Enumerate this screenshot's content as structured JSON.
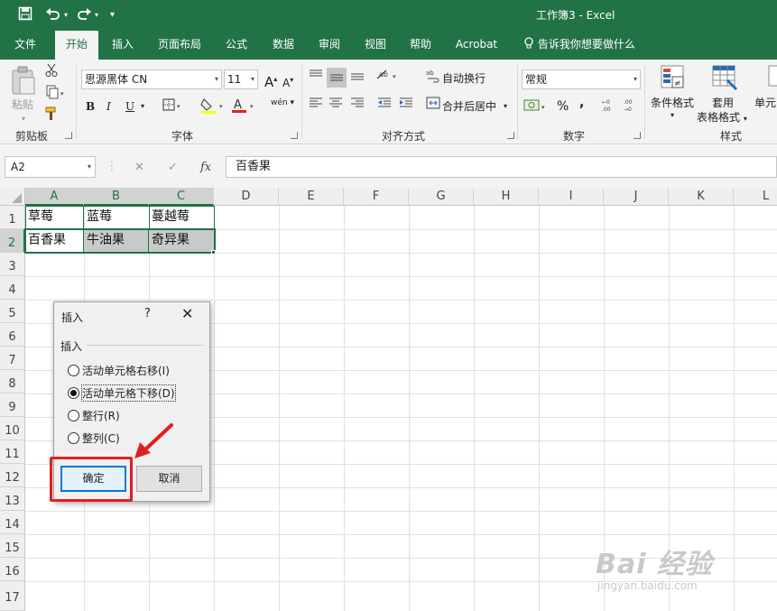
{
  "titlebar": {
    "title": "工作簿3  -  Excel",
    "save_icon": "save-icon",
    "undo_icon": "undo-icon",
    "redo_icon": "redo-icon"
  },
  "tabs": [
    "文件",
    "开始",
    "插入",
    "页面布局",
    "公式",
    "数据",
    "审阅",
    "视图",
    "帮助",
    "Acrobat",
    "告诉我你想要做什么"
  ],
  "active_tab": "开始",
  "ribbon": {
    "clipboard": {
      "paste": "粘贴",
      "label": "剪贴板"
    },
    "font": {
      "name": "思源黑体 CN",
      "size": "11",
      "bold": "B",
      "italic": "I",
      "underline": "U",
      "grow": "A",
      "shrink": "A",
      "font_color": "A",
      "wen": "wén",
      "label": "字体"
    },
    "alignment": {
      "wrap": "自动换行",
      "merge": "合并后居中",
      "label": "对齐方式"
    },
    "number": {
      "format": "常规",
      "percent": "%",
      "comma": ",",
      "label": "数字"
    },
    "styles": {
      "conditional": "条件格式",
      "table_top": "套用",
      "table_bottom": "表格格式",
      "cell_styles": "单元",
      "label": "样式"
    },
    "accent": "#217346"
  },
  "formula_bar": {
    "name_box": "A2",
    "fx": "fx",
    "content": "百香果"
  },
  "columns": [
    "A",
    "B",
    "C",
    "D",
    "E",
    "F",
    "G",
    "H",
    "I",
    "J",
    "K",
    "L"
  ],
  "rows": [
    "1",
    "2",
    "3",
    "4",
    "5",
    "6",
    "7",
    "8",
    "9",
    "10",
    "11",
    "12",
    "13",
    "14",
    "15",
    "16",
    "17"
  ],
  "cells": {
    "A1": "草莓",
    "B1": "蓝莓",
    "C1": "蔓越莓",
    "A2": "百香果",
    "B2": "牛油果",
    "C2": "奇异果"
  },
  "dialog": {
    "title": "插入",
    "help": "?",
    "close": "✕",
    "group": "插入",
    "options": [
      "活动单元格右移(I)",
      "活动单元格下移(D)",
      "整行(R)",
      "整列(C)"
    ],
    "selected": 1,
    "ok": "确定",
    "cancel": "取消"
  },
  "watermark": {
    "brand": "Bai  经验",
    "url": "jingyan.baidu.com"
  }
}
